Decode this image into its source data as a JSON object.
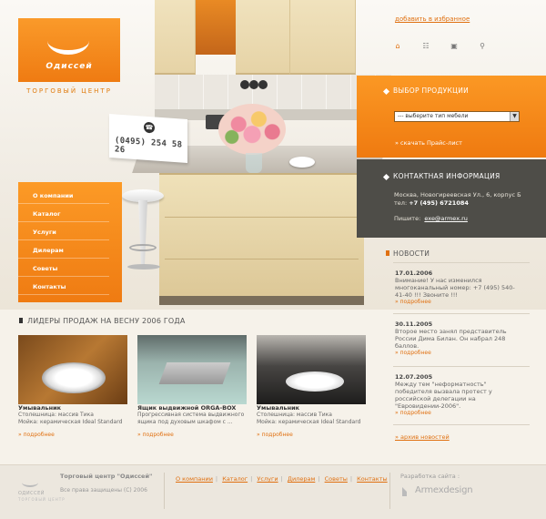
{
  "header": {
    "logo_name": "Одиссей",
    "logo_tagline": "Торговый центр",
    "phone": "(0495) 254 58 26",
    "favorite_link": "добавить в избранное",
    "tool_icons": [
      "home-icon",
      "sitemap-icon",
      "print-icon",
      "search-icon"
    ]
  },
  "menu": {
    "items": [
      "О компании",
      "Каталог",
      "Услуги",
      "Дилерам",
      "Советы",
      "Контакты"
    ]
  },
  "product_panel": {
    "title": "Выбор продукции",
    "select_value": "--- выберите тип мебели",
    "price_link": "скачать Прайс-лист"
  },
  "contact_panel": {
    "title": "Контактная информация",
    "address": "Москва, Новогиреевская Ул., 6, корпус Б",
    "phone_label": "тел:",
    "phone": "+7 (495) 6721084",
    "email_label": "Пишите:",
    "email": "exe@armex.ru"
  },
  "news": {
    "title": "Новости",
    "items": [
      {
        "date": "17.01.2006",
        "text": "Внимание! У нас изменился многоканальный номер: +7 (495) 540-41-40 !!! Звоните !!!",
        "more": "подробнее"
      },
      {
        "date": "30.11.2005",
        "text": "Второе место занял представитель России Дима Билан. Он набрал 248 баллов.",
        "more": "подробнее"
      },
      {
        "date": "12.07.2005",
        "text": "Между тем \"неформатность\" победителя вызвала протест у российской делегации на \"Евровидении-2006\".",
        "more": "подробнее"
      }
    ],
    "archive": "архив новостей"
  },
  "leaders": {
    "title": "Лидеры продаж на весну  2006 года",
    "cards": [
      {
        "title": "Умывальник",
        "desc": "Столешница: массив Тика\nМойка: керамическая Ideal Standard",
        "more": "подробнее"
      },
      {
        "title": "Ящик выдвижной ORGA-BOX",
        "desc": "Прогрессивная система выдвижного ящика под духовым шкафом с ...",
        "more": "подробнее"
      },
      {
        "title": "Умывальник",
        "desc": "Столешница: массив Тика\nМойка: керамическая Ideal Standard",
        "more": "подробнее"
      }
    ]
  },
  "footer": {
    "logo_text": "одиссей",
    "logo_sub": "торговый центр",
    "company": "Торговый центр \"Одиссей\"",
    "rights": "Все права защищены (С) 2006",
    "nav": [
      "О компании",
      "Каталог",
      "Услуги",
      "Дилерам",
      "Советы",
      "Контакты"
    ],
    "dev_label": "Разработка сайта :",
    "dev_name": "Armexdesign"
  },
  "colors": {
    "accent": "#f08414",
    "dark_panel": "#4e4d48",
    "background": "#f6f2ea"
  }
}
